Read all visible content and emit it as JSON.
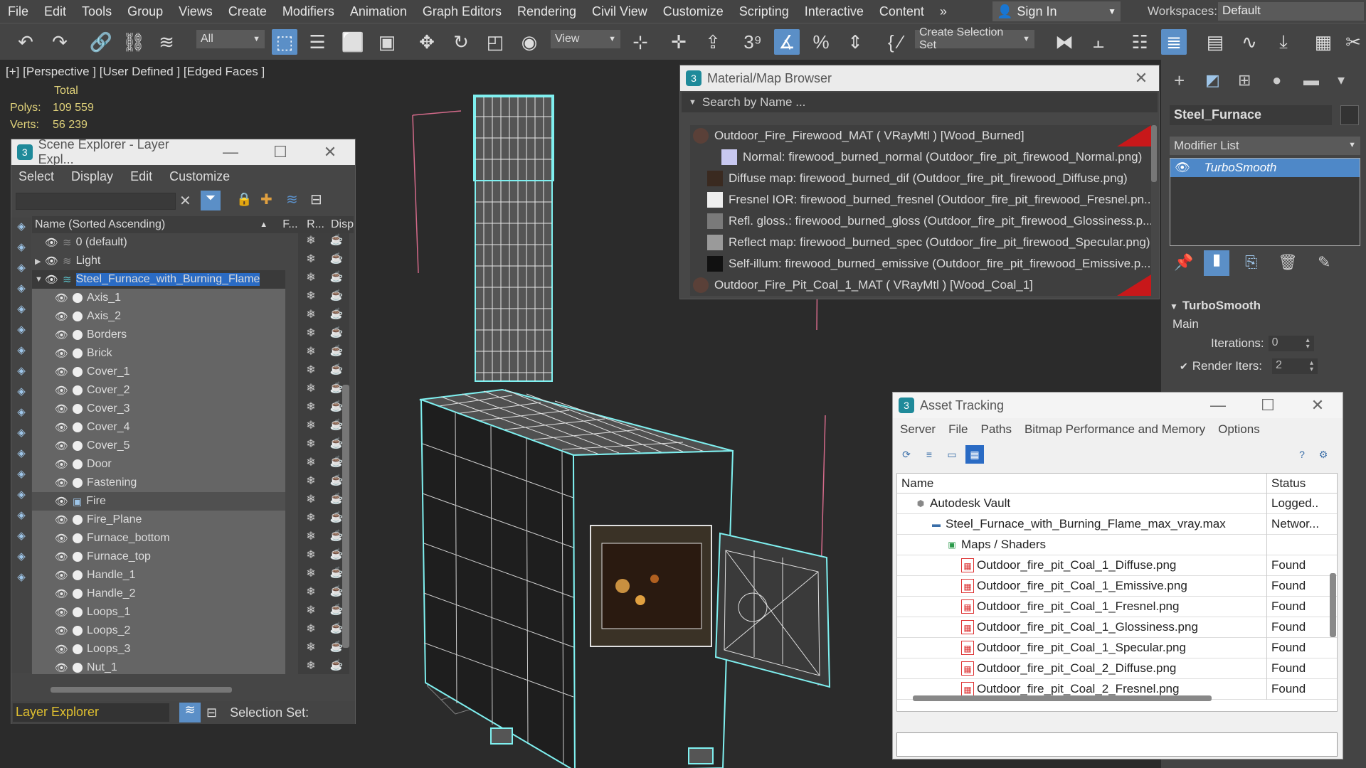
{
  "menu": [
    "File",
    "Edit",
    "Tools",
    "Group",
    "Views",
    "Create",
    "Modifiers",
    "Animation",
    "Graph Editors",
    "Rendering",
    "Civil View",
    "Customize",
    "Scripting",
    "Interactive",
    "Content"
  ],
  "menu_more": "»",
  "signin": "Sign In",
  "workspaces": {
    "label": "Workspaces:",
    "value": "Default"
  },
  "toolbar": {
    "filter": "All",
    "view": "View",
    "selection_set": "Create Selection Set"
  },
  "viewport": {
    "label": "[+] [Perspective ] [User Defined ] [Edged Faces ]",
    "total": "Total",
    "polys_label": "Polys:",
    "polys": "109 559",
    "verts_label": "Verts:",
    "verts": "56 239"
  },
  "scene_explorer": {
    "title": "Scene Explorer - Layer Expl...",
    "menu": [
      "Select",
      "Display",
      "Edit",
      "Customize"
    ],
    "col_name": "Name (Sorted Ascending)",
    "col_f": "F...",
    "col_r": "R...",
    "col_d": "Disp",
    "rows": [
      {
        "name": "0 (default)",
        "depth": 0,
        "type": "layer"
      },
      {
        "name": "Light",
        "depth": 0,
        "type": "layer",
        "collapsed": true
      },
      {
        "name": "Steel_Furnace_with_Burning_Flame",
        "depth": 0,
        "type": "layer",
        "expanded": true,
        "selected": true
      },
      {
        "name": "Axis_1",
        "depth": 1
      },
      {
        "name": "Axis_2",
        "depth": 1
      },
      {
        "name": "Borders",
        "depth": 1
      },
      {
        "name": "Brick",
        "depth": 1
      },
      {
        "name": "Cover_1",
        "depth": 1
      },
      {
        "name": "Cover_2",
        "depth": 1
      },
      {
        "name": "Cover_3",
        "depth": 1
      },
      {
        "name": "Cover_4",
        "depth": 1
      },
      {
        "name": "Cover_5",
        "depth": 1
      },
      {
        "name": "Door",
        "depth": 1
      },
      {
        "name": "Fastening",
        "depth": 1
      },
      {
        "name": "Fire",
        "depth": 1,
        "special": true
      },
      {
        "name": "Fire_Plane",
        "depth": 1
      },
      {
        "name": "Furnace_bottom",
        "depth": 1
      },
      {
        "name": "Furnace_top",
        "depth": 1
      },
      {
        "name": "Handle_1",
        "depth": 1
      },
      {
        "name": "Handle_2",
        "depth": 1
      },
      {
        "name": "Loops_1",
        "depth": 1
      },
      {
        "name": "Loops_2",
        "depth": 1
      },
      {
        "name": "Loops_3",
        "depth": 1
      },
      {
        "name": "Nut_1",
        "depth": 1
      }
    ],
    "bottom_mode": "Layer Explorer",
    "selection_set": "Selection Set:"
  },
  "material_browser": {
    "title": "Material/Map Browser",
    "search_placeholder": "Search by Name ...",
    "rows": [
      {
        "text": "Outdoor_Fire_Firewood_MAT  ( VRayMtl )  [Wood_Burned]",
        "kind": "mat"
      },
      {
        "text": "Normal: firewood_burned_normal (Outdoor_fire_pit_firewood_Normal.png)",
        "kind": "normal"
      },
      {
        "text": "Diffuse map: firewood_burned_dif (Outdoor_fire_pit_firewood_Diffuse.png)",
        "kind": "diffuse"
      },
      {
        "text": "Fresnel  IOR:  firewood_burned_fresnel  (Outdoor_fire_pit_firewood_Fresnel.pn...",
        "kind": "fresnel"
      },
      {
        "text": "Refl.  gloss.:  firewood_burned_gloss  (Outdoor_fire_pit_firewood_Glossiness.p...",
        "kind": "gloss"
      },
      {
        "text": "Reflect map: firewood_burned_spec (Outdoor_fire_pit_firewood_Specular.png)",
        "kind": "spec"
      },
      {
        "text": "Self-illum:  firewood_burned_emissive  (Outdoor_fire_pit_firewood_Emissive.p...",
        "kind": "emissive"
      },
      {
        "text": "Outdoor_Fire_Pit_Coal_1_MAT  ( VRayMtl )  [Wood_Coal_1]",
        "kind": "mat"
      }
    ]
  },
  "command_panel": {
    "object_name": "Steel_Furnace",
    "modifier_list": "Modifier List",
    "stack_item": "TurboSmooth",
    "rollout_title": "TurboSmooth",
    "group": "Main",
    "iterations_label": "Iterations:",
    "iterations": "0",
    "render_iters_label": "Render Iters:",
    "render_iters": "2"
  },
  "asset_tracking": {
    "title": "Asset Tracking",
    "menu": [
      "Server",
      "File",
      "Paths",
      "Bitmap Performance and Memory",
      "Options"
    ],
    "col_name": "Name",
    "col_status": "Status",
    "rows": [
      {
        "name": "Autodesk Vault",
        "status": "Logged...",
        "depth": 0,
        "icon": "vault"
      },
      {
        "name": "Steel_Furnace_with_Burning_Flame_max_vray.max",
        "status": "Networ...",
        "depth": 1,
        "icon": "max"
      },
      {
        "name": "Maps / Shaders",
        "status": "",
        "depth": 2,
        "icon": "maps"
      },
      {
        "name": "Outdoor_fire_pit_Coal_1_Diffuse.png",
        "status": "Found",
        "depth": 3,
        "icon": "png"
      },
      {
        "name": "Outdoor_fire_pit_Coal_1_Emissive.png",
        "status": "Found",
        "depth": 3,
        "icon": "png"
      },
      {
        "name": "Outdoor_fire_pit_Coal_1_Fresnel.png",
        "status": "Found",
        "depth": 3,
        "icon": "png"
      },
      {
        "name": "Outdoor_fire_pit_Coal_1_Glossiness.png",
        "status": "Found",
        "depth": 3,
        "icon": "png"
      },
      {
        "name": "Outdoor_fire_pit_Coal_1_Specular.png",
        "status": "Found",
        "depth": 3,
        "icon": "png"
      },
      {
        "name": "Outdoor_fire_pit_Coal_2_Diffuse.png",
        "status": "Found",
        "depth": 3,
        "icon": "png"
      },
      {
        "name": "Outdoor_fire_pit_Coal_2_Fresnel.png",
        "status": "Found",
        "depth": 3,
        "icon": "png"
      }
    ]
  },
  "colors": {
    "accent": "#5b8fc7",
    "wire": "#7ff0f0",
    "stats": "#e0d27a",
    "found_flag": "#c8181a",
    "selection_gold": "#e0c030"
  }
}
